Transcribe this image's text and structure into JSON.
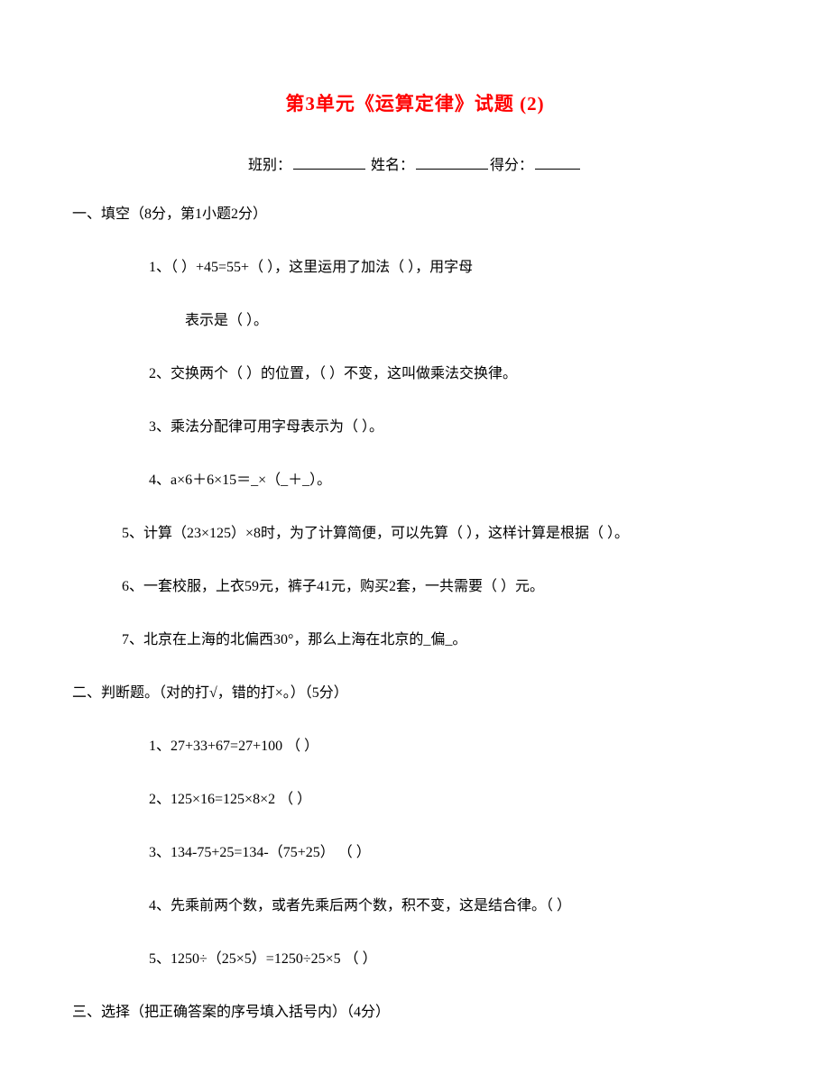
{
  "title": "第3单元《运算定律》试题 (2)",
  "header": {
    "class_label": "班别：",
    "name_label": "姓名：",
    "score_label": "得分："
  },
  "sections": {
    "s1": {
      "header": "一、填空（8分，第1小题2分）",
      "q1": "1、（  ）+45=55+（  ），这里运用了加法（  ），用字母",
      "q1_cont": "表示是（  ）。",
      "q2": "2、交换两个（  ）的位置，（  ）不变，这叫做乘法交换律。",
      "q3": "3、乘法分配律可用字母表示为（  ）。",
      "q4": "4、a×6＋6×15＝_×（_＋_）。",
      "q5": "5、计算（23×125）×8时，为了计算简便，可以先算（  ），这样计算是根据（  ）。",
      "q6": "6、一套校服，上衣59元，裤子41元，购买2套，一共需要（  ）元。",
      "q7": "7、北京在上海的北偏西30°，那么上海在北京的_偏_。"
    },
    "s2": {
      "header": "二、判断题。（对的打√，错的打×。）（5分）",
      "q1": "1、27+33+67=27+100 （  ）",
      "q2": "2、125×16=125×8×2  （  ）",
      "q3": "3、134-75+25=134-（75+25）  （  ）",
      "q4": "4、先乘前两个数，或者先乘后两个数，积不变，这是结合律。（  ）",
      "q5": "5、1250÷（25×5）=1250÷25×5 （  ）"
    },
    "s3": {
      "header": "三、选择（把正确答案的序号填入括号内）（4分）"
    }
  }
}
